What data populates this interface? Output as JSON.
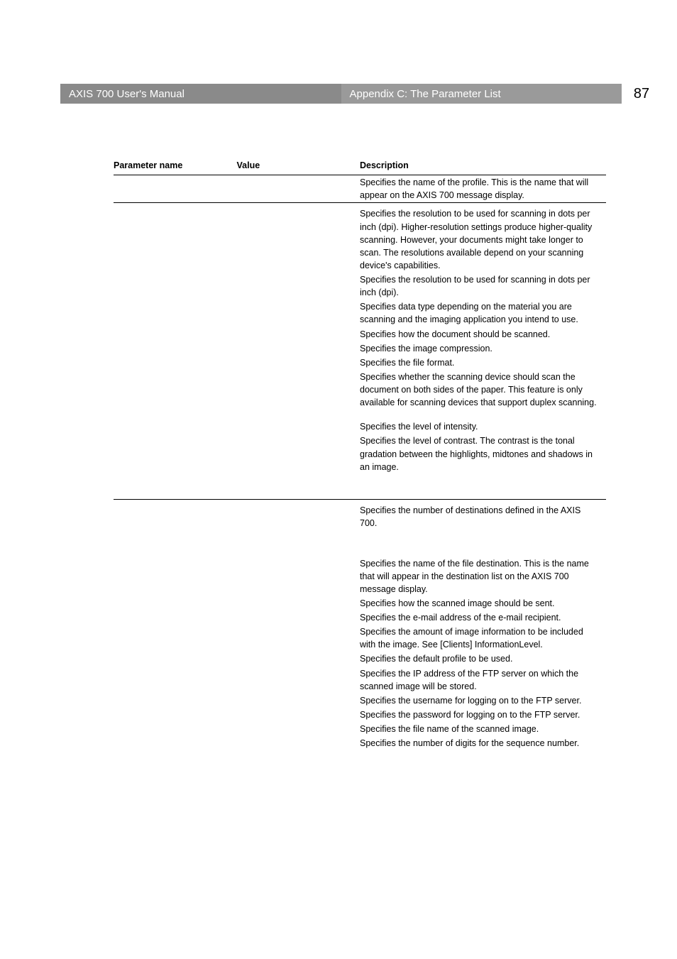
{
  "header": {
    "left": "AXIS 700 User's Manual",
    "right": "Appendix C: The Parameter List",
    "page": "87"
  },
  "table": {
    "headers": {
      "param": "Parameter name",
      "value": "Value",
      "desc": "Description"
    },
    "rows": [
      {
        "desc": "Specifies the name of the  profile. This is the name that will appear on the AXIS 700 message display."
      },
      {
        "divider": true,
        "desc": "Specifies the resolution to be used for scanning in dots per inch (dpi). Higher-resolution settings produce higher-quality scanning. However, your documents might take longer to scan. The resolutions available depend on your scanning device's capabilities."
      },
      {
        "desc": "Specifies the resolution to be used for scanning in dots per inch (dpi)."
      },
      {
        "desc": "Specifies data type depending on the material you are scanning and the imaging application you intend to use."
      },
      {
        "desc": "Specifies how the document should be scanned."
      },
      {
        "desc": "Specifies the image compression."
      },
      {
        "desc": "Specifies the file format."
      },
      {
        "desc": "Specifies whether the scanning device should scan the document on both sides of the paper. This feature is only available for scanning devices that support duplex scanning."
      },
      {
        "spacer": true
      },
      {
        "desc": "Specifies the level of intensity."
      },
      {
        "desc": "Specifies the level of contrast. The contrast is the tonal gradation between the highlights, midtones and shadows in an image."
      },
      {
        "bigspacer": true
      },
      {
        "divider": true,
        "desc": "Specifies the number of destinations defined in the AXIS 700."
      },
      {
        "bigspacer": true
      },
      {
        "desc": "Specifies the name of the file destination. This is the name that will appear in the destination list on the AXIS 700 message display."
      },
      {
        "desc": "Specifies how the scanned image should be sent."
      },
      {
        "desc": "Specifies the e-mail address of the e-mail recipient."
      },
      {
        "desc": "Specifies the amount of image information to be included with the image. See [Clients] InformationLevel."
      },
      {
        "desc": "Specifies the default  profile to be used."
      },
      {
        "desc": "Specifies the IP address of the FTP server on which the scanned image will be stored."
      },
      {
        "desc": "Specifies the username for logging on to the FTP server."
      },
      {
        "desc": "Specifies the password for logging on to the FTP server."
      },
      {
        "desc": "Specifies the file name of the scanned image."
      },
      {
        "desc": "Specifies the number of digits for the sequence number."
      }
    ]
  }
}
